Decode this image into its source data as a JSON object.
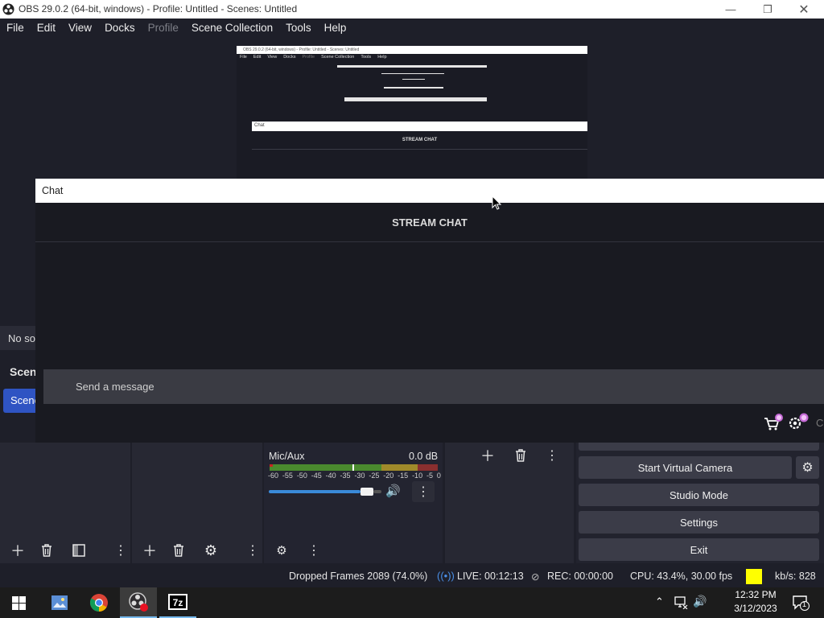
{
  "window": {
    "title": "OBS 29.0.2 (64-bit, windows) - Profile: Untitled - Scenes: Untitled",
    "minimize_icon": "minimize-icon",
    "maximize_icon": "restore-icon",
    "close_icon": "close-icon"
  },
  "menu": {
    "items": [
      "File",
      "Edit",
      "View",
      "Docks",
      "Profile",
      "Scene Collection",
      "Tools",
      "Help"
    ],
    "disabled": [
      "Profile"
    ]
  },
  "preview": {
    "title": "OBS 29.0.2 (64-bit, windows) - Profile: Untitled - Scenes: Untitled",
    "menu": [
      "File",
      "Edit",
      "View",
      "Docks",
      "Profile",
      "Scene Collection",
      "Tools",
      "Help"
    ],
    "chat_title": "Chat",
    "stream_chat": "STREAM CHAT"
  },
  "sources": {
    "empty_text": "No so"
  },
  "scenes": {
    "header": "Scen",
    "selected_item": "Scene"
  },
  "chat": {
    "title": "Chat",
    "heading": "STREAM CHAT",
    "input_placeholder": "Send a message",
    "bottom_icons": [
      "cart-icon",
      "settings-icon"
    ]
  },
  "mixer": {
    "channel": "Mic/Aux",
    "level": "0.0 dB",
    "scale": [
      "-60",
      "-55",
      "-50",
      "-45",
      "-40",
      "-35",
      "-30",
      "-25",
      "-20",
      "-15",
      "-10",
      "-5",
      "0"
    ],
    "volume_fraction": 0.92
  },
  "controls": {
    "start_virtual_camera": "Start Virtual Camera",
    "studio_mode": "Studio Mode",
    "settings": "Settings",
    "exit": "Exit"
  },
  "status": {
    "dropped_frames": "Dropped Frames 2089 (74.0%)",
    "live": "LIVE: 00:12:13",
    "rec": "REC: 00:00:00",
    "cpu": "CPU: 43.4%, 30.00 fps",
    "kbs": "kb/s: 828",
    "indicator_color": "#ffff00"
  },
  "taskbar": {
    "time": "12:32 PM",
    "date": "3/12/2023",
    "notification_count": "1",
    "apps": [
      "start-icon",
      "photos-icon",
      "chrome-icon",
      "obs-icon",
      "7zip-icon"
    ]
  },
  "colors": {
    "background": "#1e1f29",
    "accent": "#2f54c3",
    "button": "#3b3c48"
  }
}
